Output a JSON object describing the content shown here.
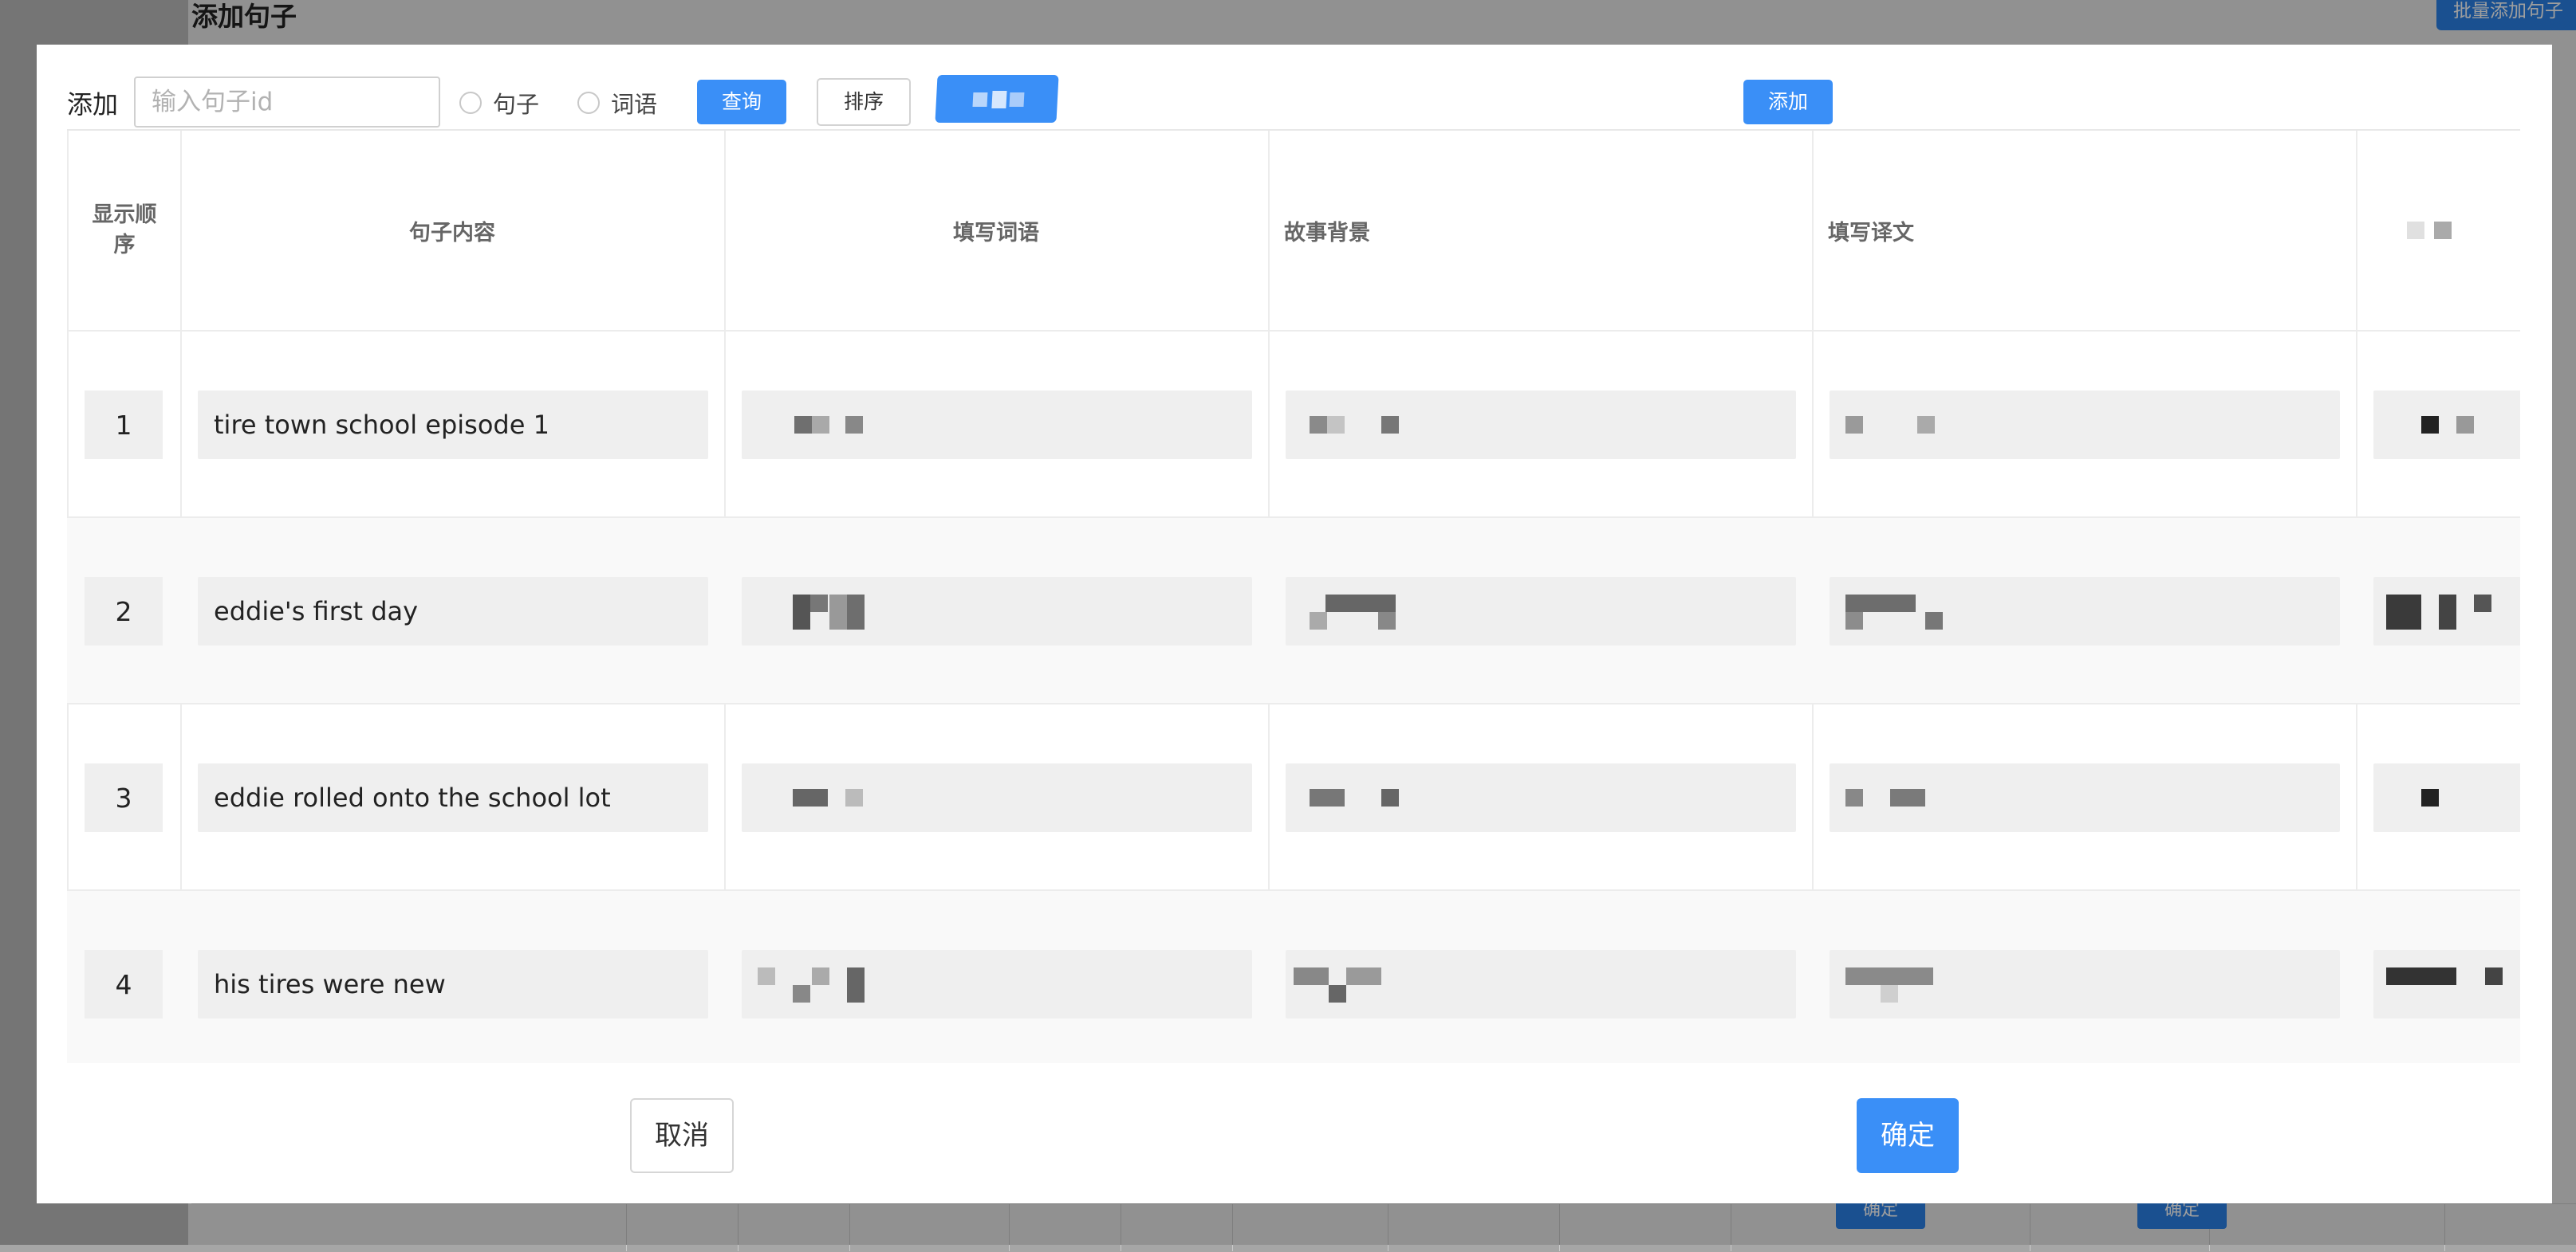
{
  "background": {
    "title": "添加句子",
    "batch_button": "批量添加句子",
    "confirm_buttons": [
      "确定",
      "确定"
    ]
  },
  "toolbar": {
    "label": "添加",
    "search_placeholder": "输入句子id",
    "radio_sentence": "句子",
    "radio_word": "词语",
    "query_button": "查询",
    "sort_button": "排序",
    "add_button": "添加"
  },
  "table": {
    "headers": [
      "显示顺序",
      "句子内容",
      "填写词语",
      "故事背景",
      "填写译文"
    ],
    "rows": [
      {
        "order": "1",
        "content": "tire town school episode 1"
      },
      {
        "order": "2",
        "content": "eddie's first day"
      },
      {
        "order": "3",
        "content": "eddie rolled onto the school lot"
      },
      {
        "order": "4",
        "content": "his tires were new"
      }
    ]
  },
  "footer": {
    "cancel_button": "取消",
    "confirm_button": "确定"
  },
  "colors": {
    "primary": "#3a8ff7",
    "overlay": "rgba(0,0,0,0.38)"
  }
}
